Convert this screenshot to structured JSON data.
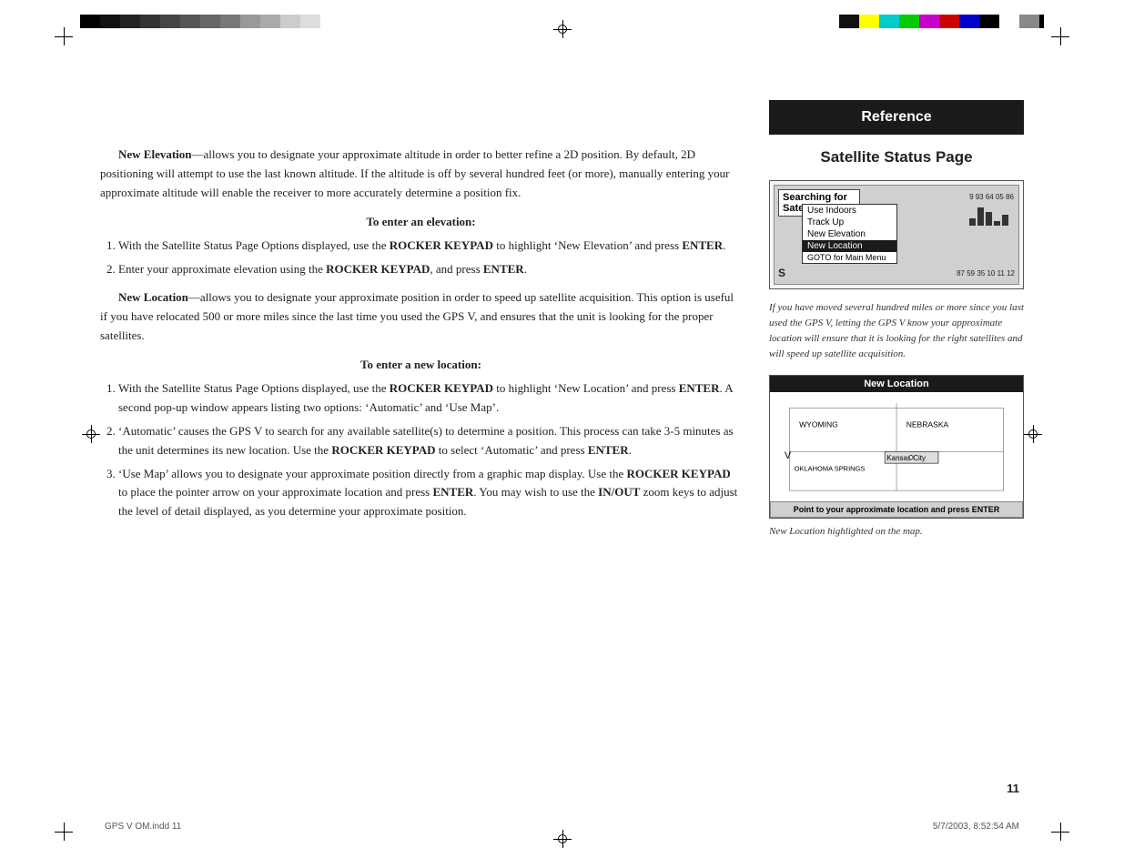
{
  "page": {
    "number": "11",
    "footer_left": "GPS V OM.indd   11",
    "footer_right": "5/7/2003, 8:52:54 AM"
  },
  "header": {
    "reference_label": "Reference"
  },
  "right_col": {
    "section_title": "Satellite Status Page",
    "sidebar_note": "If you have moved several hundred miles or more since you last used the GPS V, letting the GPS V know your approximate location will ensure that it is looking for the right satellites and will speed up satellite acquisition.",
    "map_title": "New Location",
    "map_caption": "Point to your approximate location and press ENTER",
    "map_footer": "New Location highlighted on the map.",
    "sat_screen": {
      "searching_text": "Searching for Satellites",
      "menu_items": [
        "Use Indoors",
        "Track Up",
        "New Elevation",
        "New Location",
        "GOTO for Main Menu"
      ],
      "highlighted_item": "New Location",
      "bar_nums_top": "9 93 64 05 86",
      "bar_nums_bottom": "87 59 35 10 11 12",
      "s_label": "S"
    },
    "map_labels": {
      "wyoming": "WYOMING",
      "nebraska": "NEBRASKA",
      "city": "Kansas City",
      "oklahoma": "OKLAHOMA SPRINGS"
    }
  },
  "left_col": {
    "para1_bold": "New Elevation",
    "para1_text": "—allows you to designate your approximate altitude in order to better refine a 2D position. By default, 2D positioning will attempt to use the last known altitude. If the altitude is off by several hundred feet (or more), manually entering your approximate altitude will enable the receiver to more accurately determine a position fix.",
    "heading1": "To enter an elevation:",
    "step1_1": "With the Satellite Status Page Options displayed, use the ",
    "step1_1_bold": "ROCKER KEYPAD",
    "step1_1_end": " to highlight ‘New Elevation’ and press ",
    "step1_1_enter": "ENTER",
    "step1_2": "Enter your approximate elevation using the ",
    "step1_2_bold": "ROCKER KEYPAD",
    "step1_2_end": ", and press ",
    "step1_2_enter": "ENTER",
    "para2_bold": "New Location",
    "para2_text": "—allows you to designate your approximate position in order to speed up satellite acquisition. This option is useful if you have relocated 500 or more miles since the last time you used the GPS V, and ensures that the unit is looking for the proper satellites.",
    "heading2": "To enter a new location:",
    "step2_1": "With the Satellite Status Page Options displayed, use the ",
    "step2_1_bold": "ROCKER KEYPAD",
    "step2_1_end": " to highlight ‘New Location’ and press ",
    "step2_1_enter": "ENTER",
    "step2_1_extra": ". A second pop-up window appears listing two options: ‘Automatic’ and ‘Use Map’.",
    "step2_2": "‘Automatic’ causes the GPS V to search for any available satellite(s) to determine a position. This process can take 3-5 minutes as the unit determines its new location. Use the ",
    "step2_2_bold": "ROCKER KEYPAD",
    "step2_2_end": " to select ‘Automatic’ and press ",
    "step2_2_enter": "ENTER",
    "step2_3": "‘Use Map’ allows you to designate your approximate position directly from a graphic map display. Use the ",
    "step2_3_bold": "ROCKER KEYPAD",
    "step2_3_end": " to place the pointer arrow on your approximate location and press ",
    "step2_3_enter": "ENTER",
    "step2_3_extra": ". You may wish to use the ",
    "step2_3_inout": "IN/OUT",
    "step2_3_last": " zoom keys to adjust the level of detail displayed, as you determine your approximate position."
  },
  "color_bars_left": [
    "#000000",
    "#222222",
    "#333333",
    "#444444",
    "#555555",
    "#666666",
    "#777777",
    "#888888",
    "#999999",
    "#aaaaaa",
    "#bbbbbb",
    "#cccccc"
  ],
  "color_bars_right": [
    "#ffff00",
    "#00ffff",
    "#00ff00",
    "#ff00ff",
    "#ff0000",
    "#0000ff",
    "#000000",
    "#ffffff",
    "#111111",
    "#222222",
    "#333333"
  ]
}
